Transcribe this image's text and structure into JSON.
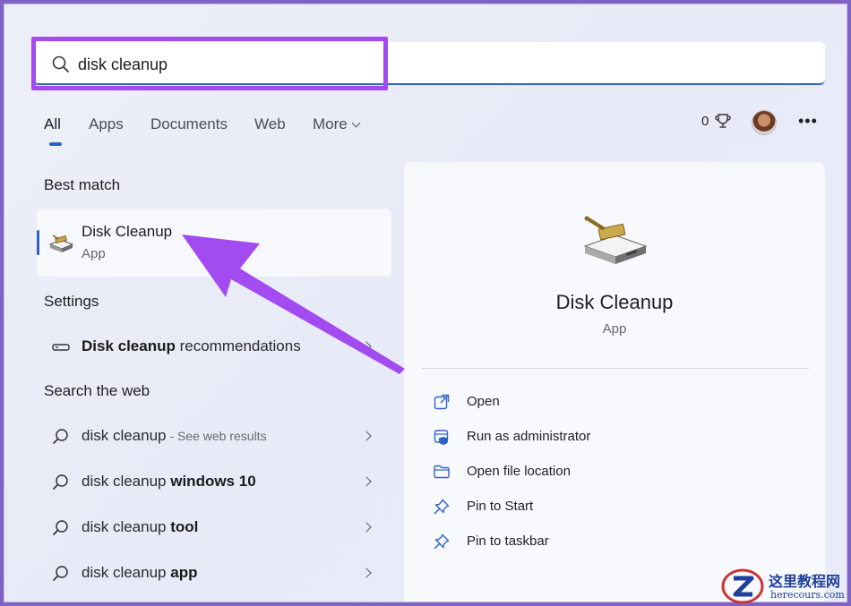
{
  "search": {
    "value": "disk cleanup"
  },
  "tabs": [
    {
      "label": "All",
      "active": true
    },
    {
      "label": "Apps"
    },
    {
      "label": "Documents"
    },
    {
      "label": "Web"
    },
    {
      "label": "More"
    }
  ],
  "header": {
    "points": "0"
  },
  "left": {
    "best_match_title": "Best match",
    "best_match": {
      "name": "Disk Cleanup",
      "type": "App"
    },
    "settings_title": "Settings",
    "settings_item": {
      "bold": "Disk cleanup",
      "rest": " recommendations"
    },
    "web_title": "Search the web",
    "web_items": [
      {
        "plain": "disk cleanup",
        "bold": "",
        "sub": " - See web results"
      },
      {
        "plain": "disk cleanup ",
        "bold": "windows 10",
        "sub": ""
      },
      {
        "plain": "disk cleanup ",
        "bold": "tool",
        "sub": ""
      },
      {
        "plain": "disk cleanup ",
        "bold": "app",
        "sub": ""
      }
    ]
  },
  "panel": {
    "title": "Disk Cleanup",
    "type": "App",
    "actions": [
      {
        "label": "Open",
        "icon": "open-external-icon"
      },
      {
        "label": "Run as administrator",
        "icon": "shield-icon"
      },
      {
        "label": "Open file location",
        "icon": "folder-icon"
      },
      {
        "label": "Pin to Start",
        "icon": "pin-icon"
      },
      {
        "label": "Pin to taskbar",
        "icon": "pin-icon"
      }
    ]
  },
  "watermark": {
    "title": "这里教程网",
    "url": "herecours.com"
  },
  "colors": {
    "accent": "#2f62c9",
    "highlight": "#a24bf0"
  }
}
